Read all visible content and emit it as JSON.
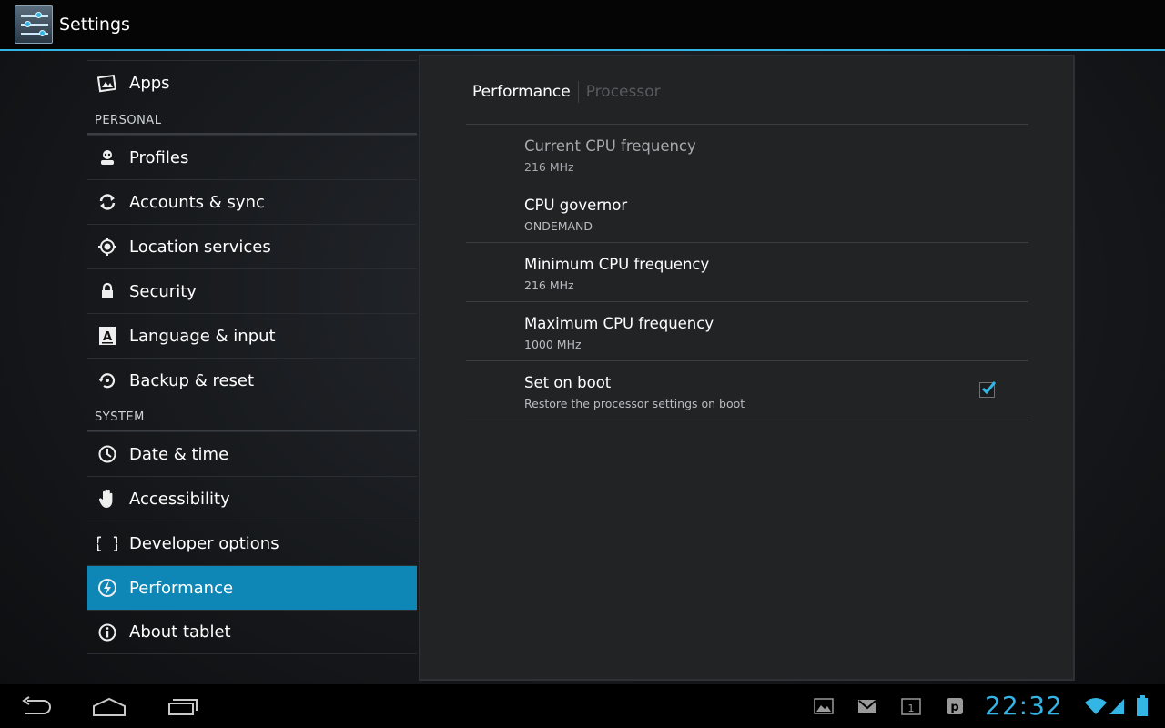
{
  "actionbar": {
    "title": "Settings"
  },
  "sidebar": {
    "items": [
      {
        "label": "Apps"
      },
      {
        "header": "PERSONAL"
      },
      {
        "label": "Profiles"
      },
      {
        "label": "Accounts & sync"
      },
      {
        "label": "Location services"
      },
      {
        "label": "Security"
      },
      {
        "label": "Language & input"
      },
      {
        "label": "Backup & reset"
      },
      {
        "header": "SYSTEM"
      },
      {
        "label": "Date & time"
      },
      {
        "label": "Accessibility"
      },
      {
        "label": "Developer options"
      },
      {
        "label": "Performance",
        "selected": true
      },
      {
        "label": "About tablet"
      }
    ]
  },
  "content": {
    "tabs": [
      {
        "label": "Performance",
        "active": true
      },
      {
        "label": "Processor",
        "active": false
      }
    ],
    "prefs": [
      {
        "title": "Current CPU frequency",
        "summary": "216 MHz",
        "enabled": false
      },
      {
        "title": "CPU governor",
        "summary": "ONDEMAND"
      },
      {
        "title": "Minimum CPU frequency",
        "summary": "216 MHz"
      },
      {
        "title": "Maximum CPU frequency",
        "summary": "1000 MHz"
      },
      {
        "title": "Set on boot",
        "summary": "Restore the processor settings on boot",
        "checked": true
      }
    ]
  },
  "statusbar": {
    "clock": "22:32"
  },
  "colors": {
    "accent": "#33b5e5",
    "selected": "#0e87b6"
  }
}
